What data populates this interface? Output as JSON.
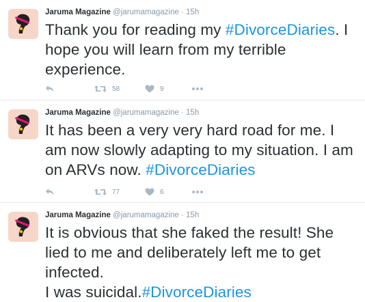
{
  "tweets": [
    {
      "author": {
        "name": "Jaruma Magazine",
        "handle": "@jarumamagazine",
        "time": "15h",
        "avatar_icon": "silhouette-avatar-icon"
      },
      "text_parts": [
        "Thank you for reading my ",
        "#DivorceDiaries",
        ". I hope you will learn from my terrible experience."
      ],
      "retweets": "58",
      "likes": "9"
    },
    {
      "author": {
        "name": "Jaruma Magazine",
        "handle": "@jarumamagazine",
        "time": "15h",
        "avatar_icon": "silhouette-avatar-icon"
      },
      "text_parts": [
        "It has been a very very hard road for me. I am now slowly adapting to my situation. I am on ARVs now. ",
        "#DivorceDiaries"
      ],
      "retweets": "77",
      "likes": "6"
    },
    {
      "author": {
        "name": "Jaruma Magazine",
        "handle": "@jarumamagazine",
        "time": "15h",
        "avatar_icon": "silhouette-avatar-icon"
      },
      "text_parts": [
        "It is obvious that she faked the result! She lied to me and deliberately left me to get infected.",
        "I was suicidal.",
        "#DivorceDiaries"
      ]
    }
  ],
  "separator": "·",
  "colors": {
    "text": "#292f33",
    "muted": "#8899a6",
    "icon": "#aab8c2",
    "hashtag": "#1b95e0",
    "avatar_bg": "#f6d6c9",
    "divider": "#e1e8ed"
  }
}
